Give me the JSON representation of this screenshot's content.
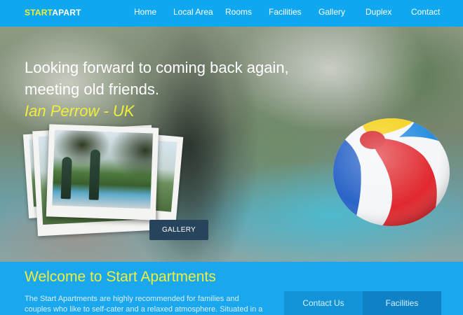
{
  "brand": {
    "part1": "START",
    "part2": "APART"
  },
  "nav": {
    "items": [
      {
        "label": "Home"
      },
      {
        "label": "Local Area"
      },
      {
        "label": "Rooms"
      },
      {
        "label": "Facilities"
      },
      {
        "label": "Gallery"
      },
      {
        "label": "Duplex"
      },
      {
        "label": "Contact"
      }
    ]
  },
  "hero": {
    "quote_lines": [
      "Looking forward to coming back again,",
      "meeting old friends."
    ],
    "author": "Ian Perrow - UK",
    "gallery_button": "GALLERY",
    "ball_icon": "beach-ball"
  },
  "welcome": {
    "title": "Welcome to Start Apartments",
    "body": "The Start Apartments are highly recommended for families and couples who like to self-cater and a relaxed atmosphere. Situated in a",
    "contact_button": "Contact Us",
    "facilities_button": "Facilities"
  },
  "colors": {
    "nav_bg": "#0fa8f0",
    "accent_yellow": "#f0ee3a",
    "gallery_button_bg": "#27445d",
    "welcome_bg": "#1aa7ee"
  }
}
